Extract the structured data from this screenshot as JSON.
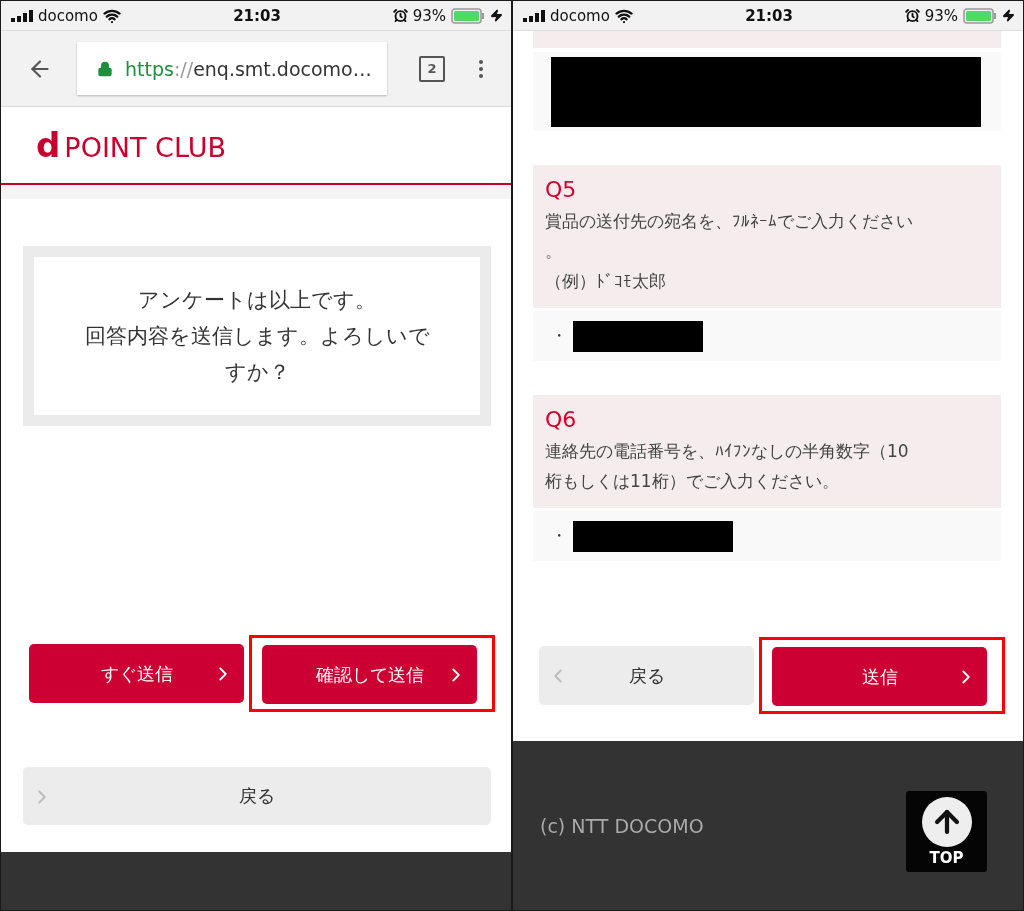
{
  "panels": [
    {
      "kind": "confirm",
      "status_bar": {
        "carrier": "docomo",
        "time": "21:03",
        "battery": "93%"
      },
      "browser": {
        "scheme": "https",
        "separator": "://",
        "host": "enq.smt.docomo…",
        "tab_count": "2"
      },
      "logo": {
        "mark": "d",
        "text": "POINT CLUB"
      },
      "message": {
        "lines": [
          "アンケートは以上です。",
          "回答内容を送信します。よろしいで",
          "すか？"
        ]
      },
      "buttons": [
        {
          "label": "すぐ送信",
          "kind": "primary",
          "highlighted": false
        },
        {
          "label": "確認して送信",
          "kind": "primary",
          "highlighted": true
        }
      ],
      "back_button": {
        "label": "戻る"
      }
    },
    {
      "kind": "form",
      "status_bar": {
        "carrier": "docomo",
        "time": "21:03",
        "battery": "93%"
      },
      "answers_top": {
        "redacted": true
      },
      "questions": [
        {
          "number": "Q5",
          "lines": [
            "賞品の送付先の宛名を、ﾌﾙﾈｰﾑでご入力ください",
            "。",
            "（例）ﾄﾞｺﾓ太郎"
          ],
          "answer": {
            "prefix": "・",
            "redacted": true
          }
        },
        {
          "number": "Q6",
          "lines": [
            "連絡先の電話番号を、ﾊｲﾌﾝなしの半角数字（10",
            "桁もしくは11桁）でご入力ください。"
          ],
          "answer": {
            "prefix": "・",
            "redacted": true
          }
        }
      ],
      "buttons": [
        {
          "label": "戻る",
          "kind": "back",
          "highlighted": false
        },
        {
          "label": "送信",
          "kind": "primary",
          "highlighted": true
        }
      ],
      "footer": {
        "copyright": "(c) NTT DOCOMO",
        "top_label": "TOP"
      }
    }
  ]
}
